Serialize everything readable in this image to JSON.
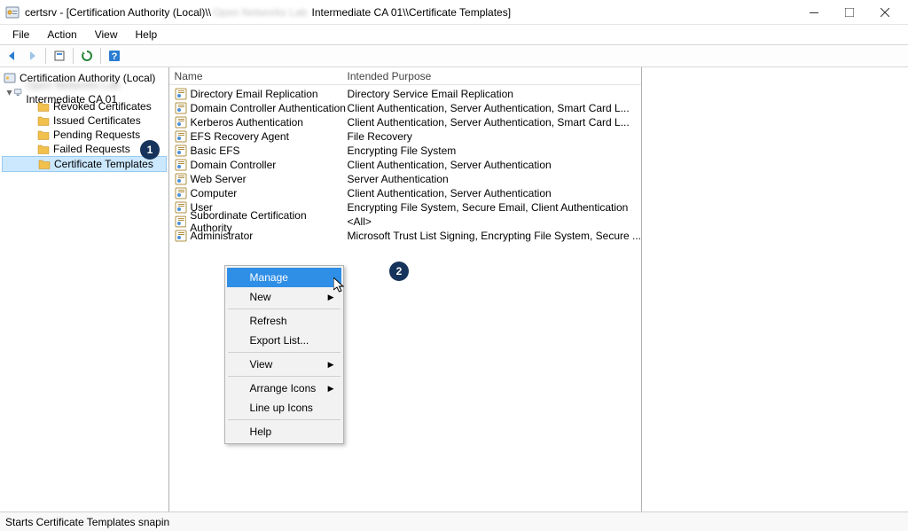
{
  "title": {
    "app": "certsrv",
    "path_prefix": "[Certification Authority (Local)\\\\",
    "path_redacted": "Open Networks Lab",
    "path_middle": " Intermediate CA 01\\\\Certificate Templates]"
  },
  "menus": [
    "File",
    "Action",
    "View",
    "Help"
  ],
  "tree": {
    "root": "Certification Authority (Local)",
    "ca_redacted": "Open Networks Lab",
    "ca_suffix": " Intermediate CA 01",
    "nodes": [
      "Revoked Certificates",
      "Issued Certificates",
      "Pending Requests",
      "Failed Requests",
      "Certificate Templates"
    ]
  },
  "columns": {
    "name": "Name",
    "purpose": "Intended Purpose"
  },
  "rows": [
    {
      "name": "Directory Email Replication",
      "purpose": "Directory Service Email Replication"
    },
    {
      "name": "Domain Controller Authentication",
      "purpose": "Client Authentication, Server Authentication, Smart Card L..."
    },
    {
      "name": "Kerberos Authentication",
      "purpose": "Client Authentication, Server Authentication, Smart Card L..."
    },
    {
      "name": "EFS Recovery Agent",
      "purpose": "File Recovery"
    },
    {
      "name": "Basic EFS",
      "purpose": "Encrypting File System"
    },
    {
      "name": "Domain Controller",
      "purpose": "Client Authentication, Server Authentication"
    },
    {
      "name": "Web Server",
      "purpose": "Server Authentication"
    },
    {
      "name": "Computer",
      "purpose": "Client Authentication, Server Authentication"
    },
    {
      "name": "User",
      "purpose": "Encrypting File System, Secure Email, Client Authentication"
    },
    {
      "name": "Subordinate Certification Authority",
      "purpose": "<All>"
    },
    {
      "name": "Administrator",
      "purpose": "Microsoft Trust List Signing, Encrypting File System, Secure ..."
    }
  ],
  "context_menu": {
    "items": [
      {
        "label": "Manage",
        "highlighted": true
      },
      {
        "label": "New",
        "submenu": true
      },
      {
        "sep": true
      },
      {
        "label": "Refresh"
      },
      {
        "label": "Export List..."
      },
      {
        "sep": true
      },
      {
        "label": "View",
        "submenu": true
      },
      {
        "sep": true
      },
      {
        "label": "Arrange Icons",
        "submenu": true
      },
      {
        "label": "Line up Icons"
      },
      {
        "sep": true
      },
      {
        "label": "Help"
      }
    ]
  },
  "badges": {
    "b1": "1",
    "b2": "2"
  },
  "statusbar": "Starts Certificate Templates snapin"
}
